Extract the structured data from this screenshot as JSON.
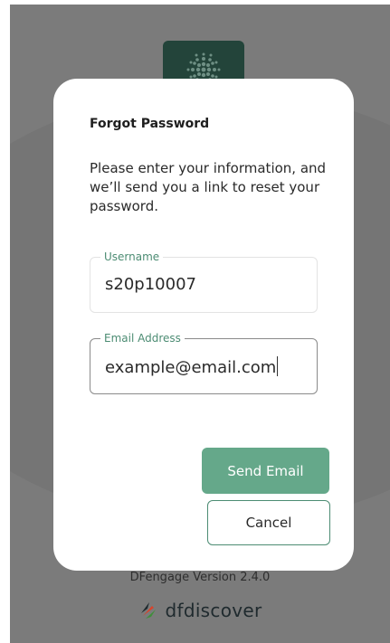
{
  "app": {
    "version": "DFengage Version 2.4.0",
    "brand_name": "dfdiscover"
  },
  "dialog": {
    "title": "Forgot Password",
    "message": "Please enter your information, and we’ll send you a link to reset your password.",
    "username": {
      "label": "Username",
      "value": "s20p10007"
    },
    "email": {
      "label": "Email Address",
      "value": "example@email.com"
    },
    "send_label": "Send Email",
    "cancel_label": "Cancel"
  },
  "colors": {
    "accent": "#65a88a",
    "label": "#4c8c73",
    "logo_tile": "#23443a"
  }
}
